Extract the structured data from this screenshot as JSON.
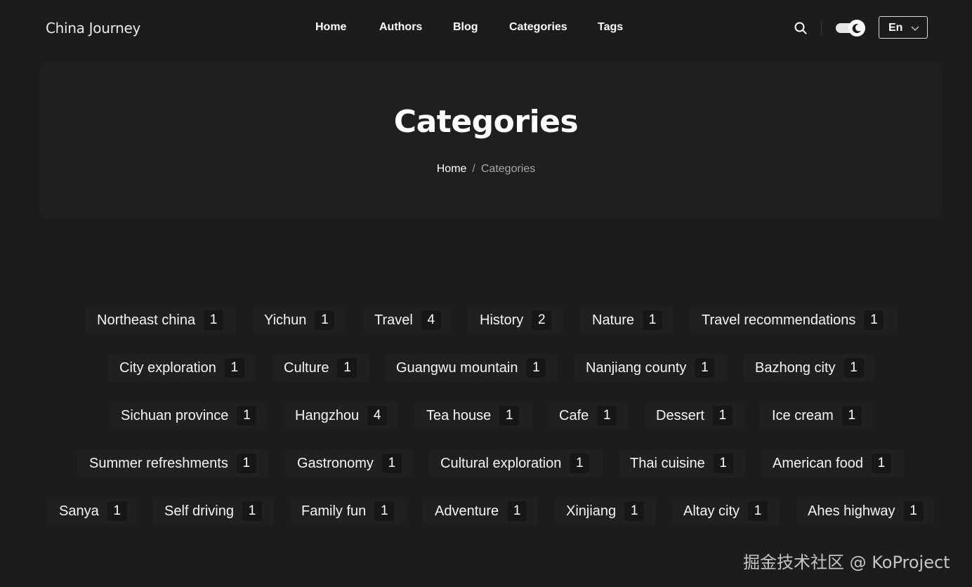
{
  "header": {
    "logo": "China Journey",
    "nav": [
      {
        "label": "Home"
      },
      {
        "label": "Authors"
      },
      {
        "label": "Blog"
      },
      {
        "label": "Categories"
      },
      {
        "label": "Tags"
      }
    ],
    "language": "En",
    "theme_mode": "dark"
  },
  "hero": {
    "title": "Categories",
    "breadcrumb": {
      "home": "Home",
      "separator": "/",
      "current": "Categories"
    }
  },
  "categories": [
    {
      "label": "Northeast china",
      "count": "1"
    },
    {
      "label": "Yichun",
      "count": "1"
    },
    {
      "label": "Travel",
      "count": "4"
    },
    {
      "label": "History",
      "count": "2"
    },
    {
      "label": "Nature",
      "count": "1"
    },
    {
      "label": "Travel recommendations",
      "count": "1"
    },
    {
      "label": "City exploration",
      "count": "1"
    },
    {
      "label": "Culture",
      "count": "1"
    },
    {
      "label": "Guangwu mountain",
      "count": "1"
    },
    {
      "label": "Nanjiang county",
      "count": "1"
    },
    {
      "label": "Bazhong city",
      "count": "1"
    },
    {
      "label": "Sichuan province",
      "count": "1"
    },
    {
      "label": "Hangzhou",
      "count": "4"
    },
    {
      "label": "Tea house",
      "count": "1"
    },
    {
      "label": "Cafe",
      "count": "1"
    },
    {
      "label": "Dessert",
      "count": "1"
    },
    {
      "label": "Ice cream",
      "count": "1"
    },
    {
      "label": "Summer refreshments",
      "count": "1"
    },
    {
      "label": "Gastronomy",
      "count": "1"
    },
    {
      "label": "Cultural exploration",
      "count": "1"
    },
    {
      "label": "Thai cuisine",
      "count": "1"
    },
    {
      "label": "American food",
      "count": "1"
    },
    {
      "label": "Sanya",
      "count": "1"
    },
    {
      "label": "Self driving",
      "count": "1"
    },
    {
      "label": "Family fun",
      "count": "1"
    },
    {
      "label": "Adventure",
      "count": "1"
    },
    {
      "label": "Xinjiang",
      "count": "1"
    },
    {
      "label": "Altay city",
      "count": "1"
    },
    {
      "label": "Ahes highway",
      "count": "1"
    }
  ],
  "watermark": "掘金技术社区 @ KoProject",
  "colors": {
    "background": "#1c1c1c",
    "panel": "#1f1f1f",
    "chip": "#202020",
    "text": "#ffffff",
    "muted": "#a8a8a8"
  },
  "icons": {
    "search": "search-icon",
    "theme_toggle": "moon-icon",
    "dropdown": "chevron-down-icon"
  }
}
